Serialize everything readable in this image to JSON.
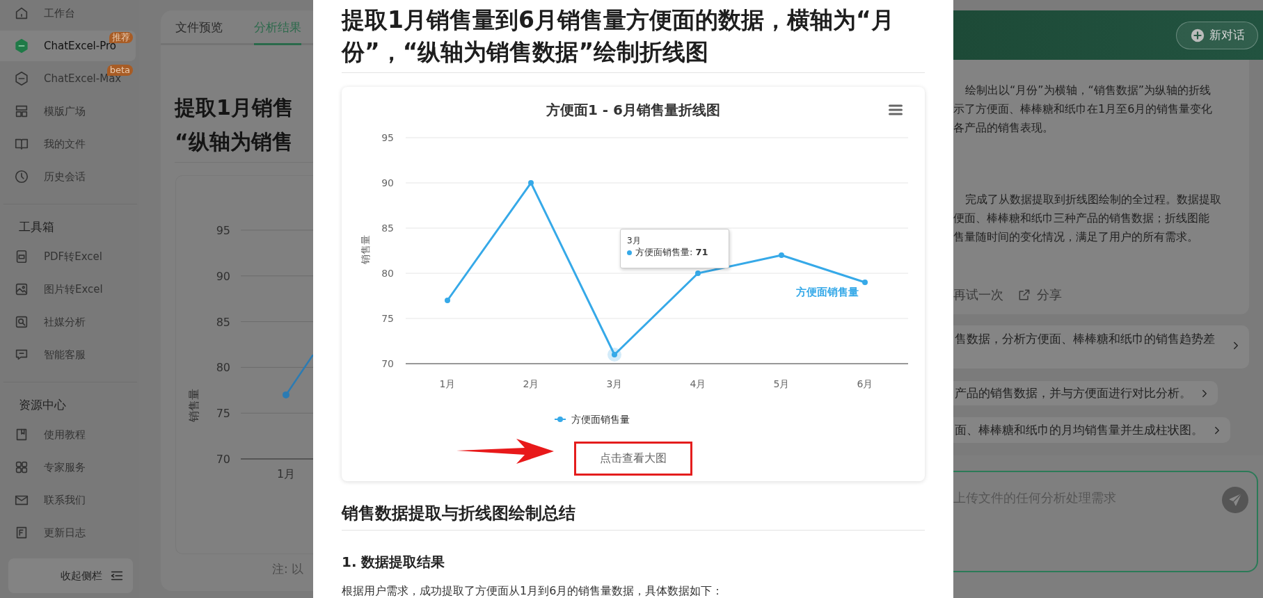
{
  "sidebar": {
    "nav": [
      {
        "label": "工作台",
        "selected": false
      },
      {
        "label": "ChatExcel-Pro",
        "badge": "推荐",
        "selected": true
      },
      {
        "label": "ChatExcel-Max",
        "badge": "beta",
        "selected": false
      },
      {
        "label": "模版广场",
        "selected": false
      },
      {
        "label": "我的文件",
        "selected": false
      },
      {
        "label": "历史会话",
        "selected": false
      }
    ],
    "sections": [
      {
        "title": "工具箱",
        "items": [
          {
            "label": "PDF转Excel",
            "selected": false
          },
          {
            "label": "图片转Excel",
            "selected": false
          },
          {
            "label": "社媒分析",
            "selected": false
          },
          {
            "label": "智能客服",
            "selected": false
          }
        ]
      },
      {
        "title": "资源中心",
        "items": [
          {
            "label": "使用教程",
            "selected": false
          },
          {
            "label": "专家服务",
            "selected": false
          },
          {
            "label": "联系我们",
            "selected": false
          },
          {
            "label": "更新日志",
            "selected": false
          }
        ]
      }
    ],
    "collapse_button": "收起侧栏"
  },
  "background_panel": {
    "tabs": [
      {
        "label": "文件预览",
        "selected": false
      },
      {
        "label": "分析结果",
        "selected": true
      }
    ],
    "title_lines": [
      "提取1月销售",
      "“纵轴为销售"
    ],
    "chart_data": {
      "type": "line",
      "ylabel": "销售量",
      "categories": [
        "1月"
      ],
      "series": [
        {
          "color": "#2b7bb3",
          "marker": "circle",
          "values": [
            77
          ]
        }
      ],
      "ylim": [
        70,
        95
      ],
      "yticks": [
        70,
        75,
        80,
        85,
        90,
        95
      ],
      "grid": true
    },
    "note": "注: 以"
  },
  "modal": {
    "title": "提取1月销售量到6月销售量方便面的数据，横轴为“月份”，“纵轴为销售数据”绘制折线图",
    "chart_data": {
      "type": "line",
      "title": "方便面1 - 6月销售量折线图",
      "ylabel": "销售量",
      "categories": [
        "1月",
        "2月",
        "3月",
        "4月",
        "5月",
        "6月"
      ],
      "series": [
        {
          "name": "方便面销售量",
          "color": "#36a9e8",
          "marker": "circle",
          "values": [
            77,
            90,
            71,
            80,
            82,
            79
          ]
        }
      ],
      "ylim": [
        70,
        95
      ],
      "yticks": [
        70,
        75,
        80,
        85,
        90,
        95
      ],
      "grid": true
    },
    "series_label": "方便面销售量",
    "tooltip": {
      "category": "3月",
      "text": "方便面销售量: **71**"
    },
    "view_button": "点击查看大图",
    "summary_heading": "销售数据提取与折线图绘制总结",
    "section_heading": "1. 数据提取结果",
    "paragraph": "根据用户需求，成功提取了方便面从1月到6月的销售量数据，具体数据如下："
  },
  "chat_panel": {
    "new_chat_button": "新对话",
    "answer_paragraphs": [
      [
        "绘制出以“月份”为横轴，“销售数据”为纵轴的折线",
        "示了方便面、棒棒糖和纸巾在1月至6月的销售量变化",
        "各产品的销售表现。"
      ],
      [
        "完成了从数据提取到折线图绘制的全过程。数据提取",
        "便面、棒棒糖和纸巾三种产品的销售数据；折线图能",
        "售量随时间的变化情况，满足了用户的所有需求。"
      ]
    ],
    "actions": [
      "再试一次",
      "分享"
    ],
    "suggestions": [
      "售数据，分析方便面、棒棒糖和纸巾的销售趋势差",
      "产品的销售数据，并与方便面进行对比分析。",
      "面、棒棒糖和纸巾的月均销售量并生成柱状图。"
    ],
    "input": {
      "placeholder": "上传文件的任何分析处理需求"
    }
  }
}
